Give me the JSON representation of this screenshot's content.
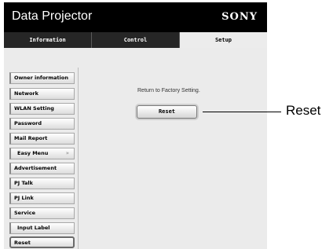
{
  "header": {
    "title": "Data Projector",
    "brand": "SONY"
  },
  "tabs": [
    {
      "label": "Information"
    },
    {
      "label": "Control"
    },
    {
      "label": "Setup"
    }
  ],
  "active_tab": "Setup",
  "sidebar": {
    "items": [
      {
        "label": "Owner information"
      },
      {
        "label": "Network"
      },
      {
        "label": "WLAN Setting"
      },
      {
        "label": "Password"
      },
      {
        "label": "Mail Report"
      },
      {
        "label": "Easy Menu",
        "caret": "»"
      },
      {
        "label": "Advertisement"
      },
      {
        "label": "PJ Talk"
      },
      {
        "label": "PJ Link"
      },
      {
        "label": "Service"
      },
      {
        "label": "Input Label"
      },
      {
        "label": "Reset"
      }
    ],
    "selected": "Reset"
  },
  "main": {
    "description": "Return to Factory Setting.",
    "reset_button": "Reset"
  },
  "callout": {
    "label": "Reset"
  }
}
